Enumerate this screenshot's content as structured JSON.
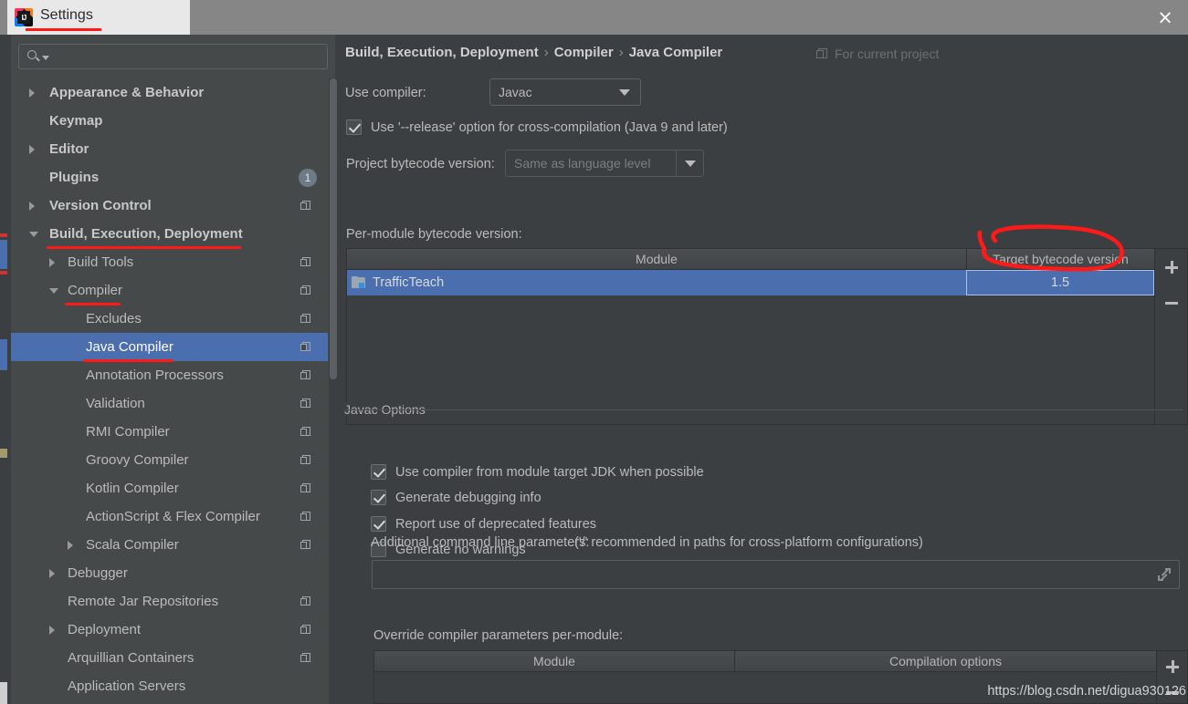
{
  "window": {
    "title": "Settings",
    "close_label": "×",
    "logo_text": "IJ"
  },
  "sidebar": {
    "search": {
      "value": "",
      "placeholder": ""
    },
    "items": [
      {
        "label": "Appearance & Behavior",
        "indent": 1,
        "arrow": "collapsed",
        "bold": true,
        "copy": false,
        "badge": null,
        "selected": false,
        "annotated": false
      },
      {
        "label": "Keymap",
        "indent": 1,
        "arrow": "none",
        "bold": true,
        "copy": false,
        "badge": null,
        "selected": false,
        "annotated": false
      },
      {
        "label": "Editor",
        "indent": 1,
        "arrow": "collapsed",
        "bold": true,
        "copy": false,
        "badge": null,
        "selected": false,
        "annotated": false
      },
      {
        "label": "Plugins",
        "indent": 1,
        "arrow": "none",
        "bold": true,
        "copy": false,
        "badge": "1",
        "selected": false,
        "annotated": false
      },
      {
        "label": "Version Control",
        "indent": 1,
        "arrow": "collapsed",
        "bold": true,
        "copy": true,
        "badge": null,
        "selected": false,
        "annotated": false
      },
      {
        "label": "Build, Execution, Deployment",
        "indent": 1,
        "arrow": "expanded",
        "bold": true,
        "copy": false,
        "badge": null,
        "selected": false,
        "annotated": true
      },
      {
        "label": "Build Tools",
        "indent": 2,
        "arrow": "collapsed",
        "bold": false,
        "copy": true,
        "badge": null,
        "selected": false,
        "annotated": false
      },
      {
        "label": "Compiler",
        "indent": 2,
        "arrow": "expanded",
        "bold": false,
        "copy": true,
        "badge": null,
        "selected": false,
        "annotated": true
      },
      {
        "label": "Excludes",
        "indent": 3,
        "arrow": "none",
        "bold": false,
        "copy": true,
        "badge": null,
        "selected": false,
        "annotated": false
      },
      {
        "label": "Java Compiler",
        "indent": 3,
        "arrow": "none",
        "bold": false,
        "copy": true,
        "badge": null,
        "selected": true,
        "annotated": true
      },
      {
        "label": "Annotation Processors",
        "indent": 3,
        "arrow": "none",
        "bold": false,
        "copy": true,
        "badge": null,
        "selected": false,
        "annotated": false
      },
      {
        "label": "Validation",
        "indent": 3,
        "arrow": "none",
        "bold": false,
        "copy": true,
        "badge": null,
        "selected": false,
        "annotated": false
      },
      {
        "label": "RMI Compiler",
        "indent": 3,
        "arrow": "none",
        "bold": false,
        "copy": true,
        "badge": null,
        "selected": false,
        "annotated": false
      },
      {
        "label": "Groovy Compiler",
        "indent": 3,
        "arrow": "none",
        "bold": false,
        "copy": true,
        "badge": null,
        "selected": false,
        "annotated": false
      },
      {
        "label": "Kotlin Compiler",
        "indent": 3,
        "arrow": "none",
        "bold": false,
        "copy": true,
        "badge": null,
        "selected": false,
        "annotated": false
      },
      {
        "label": "ActionScript & Flex Compiler",
        "indent": 3,
        "arrow": "none",
        "bold": false,
        "copy": true,
        "badge": null,
        "selected": false,
        "annotated": false
      },
      {
        "label": "Scala Compiler",
        "indent": 3,
        "arrow": "collapsed",
        "bold": false,
        "copy": true,
        "badge": null,
        "selected": false,
        "annotated": false
      },
      {
        "label": "Debugger",
        "indent": 2,
        "arrow": "collapsed",
        "bold": false,
        "copy": false,
        "badge": null,
        "selected": false,
        "annotated": false
      },
      {
        "label": "Remote Jar Repositories",
        "indent": 2,
        "arrow": "none",
        "bold": false,
        "copy": true,
        "badge": null,
        "selected": false,
        "annotated": false
      },
      {
        "label": "Deployment",
        "indent": 2,
        "arrow": "collapsed",
        "bold": false,
        "copy": true,
        "badge": null,
        "selected": false,
        "annotated": false
      },
      {
        "label": "Arquillian Containers",
        "indent": 2,
        "arrow": "none",
        "bold": false,
        "copy": true,
        "badge": null,
        "selected": false,
        "annotated": false
      },
      {
        "label": "Application Servers",
        "indent": 2,
        "arrow": "none",
        "bold": false,
        "copy": false,
        "badge": null,
        "selected": false,
        "annotated": false
      }
    ]
  },
  "main": {
    "breadcrumb": [
      "Build, Execution, Deployment",
      "Compiler",
      "Java Compiler"
    ],
    "breadcrumb_separator": "›",
    "scope_label": "For current project",
    "use_compiler_label": "Use compiler:",
    "use_compiler_value": "Javac",
    "release_option_label": "Use '--release' option for cross-compilation (Java 9 and later)",
    "release_option_checked": true,
    "project_bytecode_label": "Project bytecode version:",
    "project_bytecode_value": "Same as language level",
    "per_module_label": "Per-module bytecode version:",
    "bytecode_table": {
      "columns": [
        "Module",
        "Target bytecode version"
      ],
      "rows": [
        {
          "module": "TrafficTeach",
          "target": "1.5",
          "selected": true
        }
      ],
      "add_label": "+",
      "remove_label": "−"
    },
    "javac_options": {
      "title": "Javac Options",
      "checkboxes": [
        {
          "label": "Use compiler from module target JDK when possible",
          "checked": true
        },
        {
          "label": "Generate debugging info",
          "checked": true
        },
        {
          "label": "Report use of deprecated features",
          "checked": true
        },
        {
          "label": "Generate no warnings",
          "checked": false
        }
      ],
      "additional_params_label": "Additional command line parameters:",
      "additional_params_hint": "('/' recommended in paths for cross-platform configurations)",
      "additional_params_value": ""
    },
    "override_label": "Override compiler parameters per-module:",
    "override_table": {
      "columns": [
        "Module",
        "Compilation options"
      ],
      "rows": [],
      "add_label": "+",
      "remove_label": "−"
    },
    "watermark": "https://blog.csdn.net/digua930126"
  },
  "colors": {
    "selection": "#4b6eaf",
    "annotation": "#ff1a1a",
    "panel_bg": "#3c3f41",
    "sidebar_bg": "#45494a",
    "text": "#bbbbbb"
  }
}
